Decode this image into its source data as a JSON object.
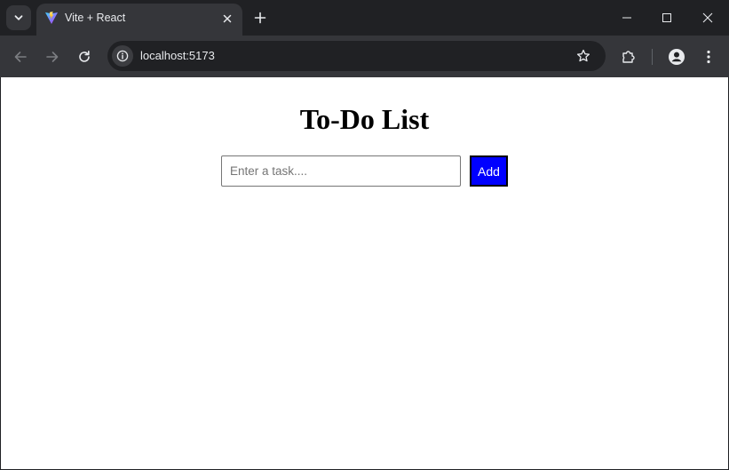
{
  "browser": {
    "tab": {
      "title": "Vite + React",
      "favicon": "vite-logo-icon"
    },
    "url": "localhost:5173",
    "icons": {
      "tab_search": "chevron-down-icon",
      "close_tab": "close-icon",
      "new_tab": "plus-icon",
      "minimize": "minimize-icon",
      "maximize": "maximize-icon",
      "close_window": "close-icon",
      "back": "arrow-left-icon",
      "forward": "arrow-right-icon",
      "reload": "reload-icon",
      "site_info": "info-icon",
      "bookmark": "star-icon",
      "extensions": "puzzle-icon",
      "profile": "profile-icon",
      "menu": "kebab-menu-icon"
    }
  },
  "page": {
    "title": "To-Do List",
    "task_input": {
      "placeholder": "Enter a task....",
      "value": ""
    },
    "add_button": {
      "label": "Add"
    }
  },
  "colors": {
    "chrome_dark": "#202124",
    "chrome_toolbar": "#35363a",
    "page_background": "#ffffff",
    "add_button_bg": "#0000ff",
    "add_button_text": "#ffffff"
  }
}
